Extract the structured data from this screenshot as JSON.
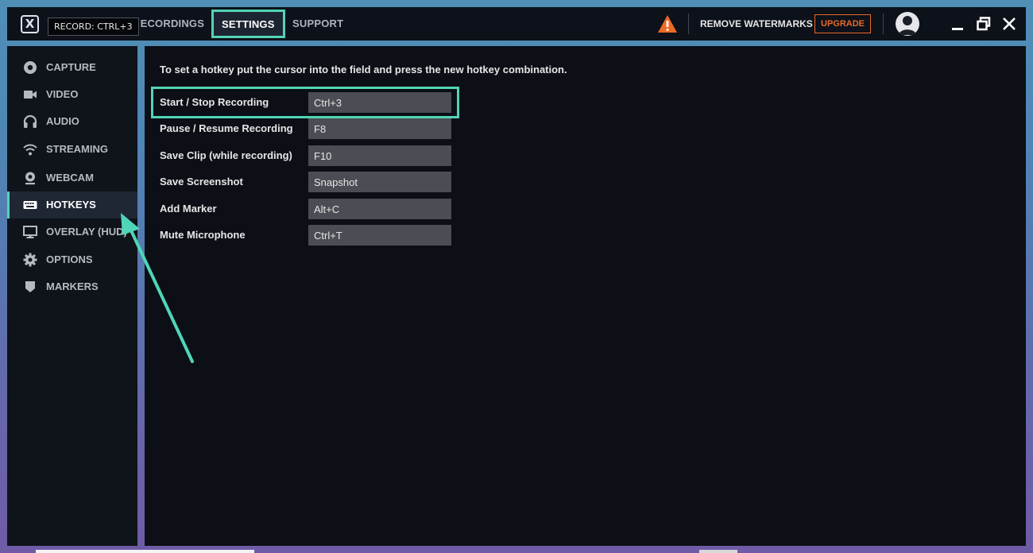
{
  "tooltip": "RECORD: CTRL+3",
  "nav": {
    "tabs": [
      {
        "label": "RECORDINGS"
      },
      {
        "label": "SETTINGS"
      },
      {
        "label": "SUPPORT"
      }
    ],
    "remove_watermarks": "REMOVE WATERMARKS",
    "upgrade": "UPGRADE"
  },
  "sidebar": {
    "items": [
      {
        "label": "CAPTURE",
        "icon": "record-icon"
      },
      {
        "label": "VIDEO",
        "icon": "video-camera-icon"
      },
      {
        "label": "AUDIO",
        "icon": "headphones-icon"
      },
      {
        "label": "STREAMING",
        "icon": "wifi-icon"
      },
      {
        "label": "WEBCAM",
        "icon": "webcam-icon"
      },
      {
        "label": "HOTKEYS",
        "icon": "keyboard-icon",
        "active": true
      },
      {
        "label": "OVERLAY (HUD)",
        "icon": "monitor-icon"
      },
      {
        "label": "OPTIONS",
        "icon": "gear-icon"
      },
      {
        "label": "MARKERS",
        "icon": "shield-icon"
      }
    ]
  },
  "main": {
    "instruction": "To set a hotkey put the cursor into the field and press the new hotkey combination.",
    "hotkeys": [
      {
        "label": "Start / Stop Recording",
        "value": "Ctrl+3"
      },
      {
        "label": "Pause / Resume Recording",
        "value": "F8"
      },
      {
        "label": "Save Clip (while recording)",
        "value": "F10"
      },
      {
        "label": "Save Screenshot",
        "value": "Snapshot"
      },
      {
        "label": "Add Marker",
        "value": "Alt+C"
      },
      {
        "label": "Mute Microphone",
        "value": "Ctrl+T"
      }
    ]
  },
  "colors": {
    "accent": "#52d4b6",
    "upgrade": "#e8692c",
    "warning": "#ee6a24",
    "panel": "#0c0f16"
  }
}
